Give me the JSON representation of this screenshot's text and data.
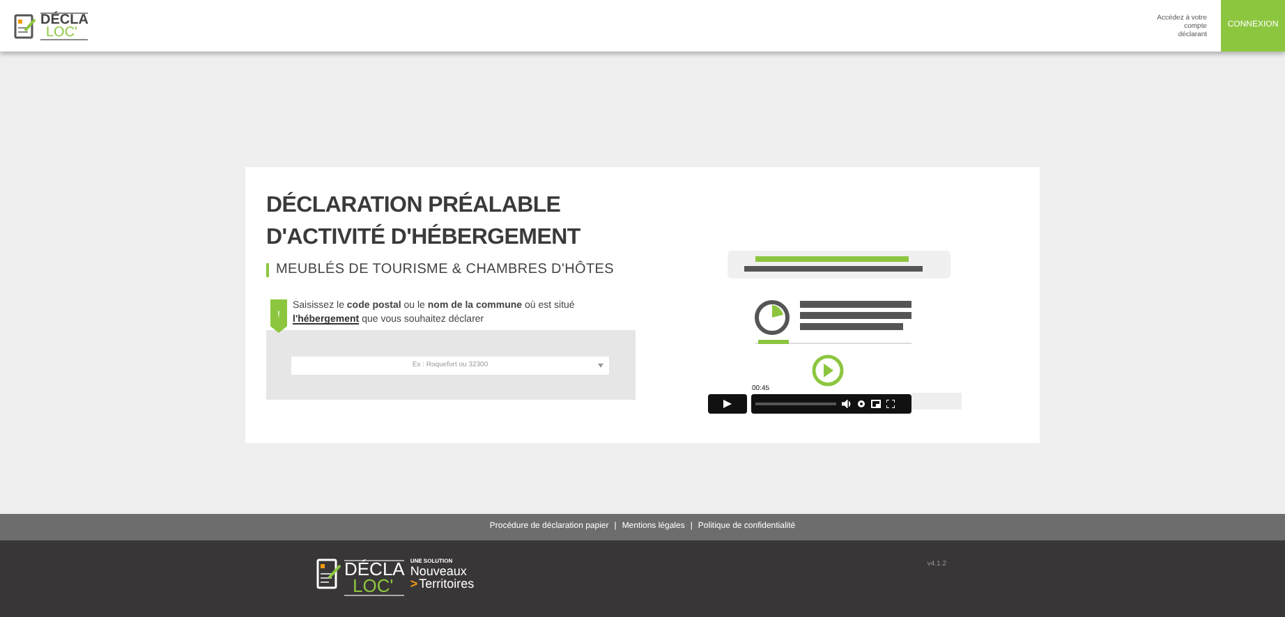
{
  "header": {
    "logo": {
      "top": "DÉCLA",
      "bottom": "LOC'"
    },
    "account_text": "Accédez à votre compte déclarant",
    "login_button": "CONNEXION"
  },
  "card": {
    "title_lines": [
      "DÉCLARATION PRÉALABLE",
      "D'ACTIVITÉ D'HÉBERGEMENT"
    ],
    "subtitle": "MEUBLÉS DE TOURISME & CHAMBRES D'HÔTES",
    "hint_badge": "!",
    "hint": "Saisissez le **code postal** ou le **nom de la commune** où est situé",
    "hint_link": "l'hébergement",
    "hint_end": "que vous souhaitez déclarer",
    "search": {
      "placeholder": "Ex : Roquefort ou 32300"
    },
    "video": {
      "kind": "picture",
      "time": "00:45"
    }
  },
  "footer": {
    "links": [
      "Procédure de déclaration papier",
      "Mentions légales",
      "Politique de confidentialité"
    ],
    "separator": "|",
    "logo": {
      "top": "DÉCLA",
      "bottom": "LOC'",
      "tagline": "UNE SOLUTION",
      "partner_top": "Nouveaux",
      "partner_bottom": "Territoires",
      "arrow": ">"
    },
    "version": "v4.1.2"
  }
}
